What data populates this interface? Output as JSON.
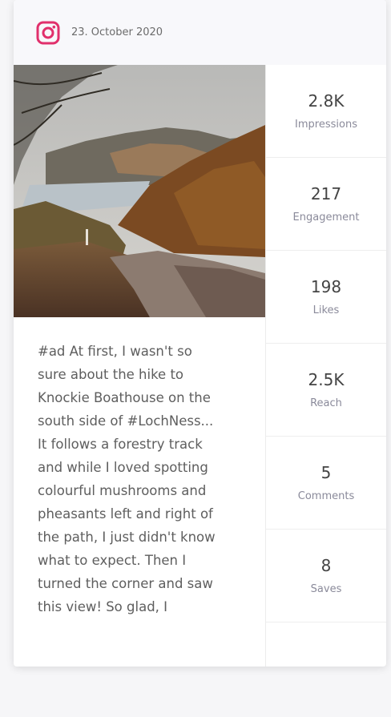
{
  "post": {
    "platform_icon": "instagram-icon",
    "accent_color": "#e1306c",
    "date": "23. October 2020",
    "image_subject": "autumn-lake-forestry-track-photo",
    "caption": "#ad At first, I wasn't so\nsure about the hike to\nKnockie Boathouse on the\nsouth side of #LochNess...\nIt follows a forestry track\nand while I loved spotting\ncolourful mushrooms and\npheasants left and right of\nthe path, I just didn't know\nwhat to expect. Then I\nturned the corner and saw\nthis view! So glad, I"
  },
  "stats": [
    {
      "value": "2.8K",
      "label": "Impressions"
    },
    {
      "value": "217",
      "label": "Engagement"
    },
    {
      "value": "198",
      "label": "Likes"
    },
    {
      "value": "2.5K",
      "label": "Reach"
    },
    {
      "value": "5",
      "label": "Comments"
    },
    {
      "value": "8",
      "label": "Saves"
    }
  ]
}
